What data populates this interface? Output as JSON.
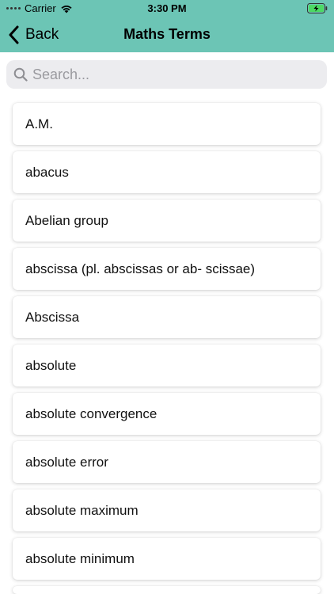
{
  "status_bar": {
    "carrier": "Carrier",
    "time": "3:30 PM"
  },
  "nav": {
    "back_label": "Back",
    "title": "Maths Terms"
  },
  "search": {
    "placeholder": "Search..."
  },
  "terms": [
    "A.M.",
    "abacus",
    "Abelian group",
    "abscissa (pl. abscissas or ab- scissae)",
    "Abscissa",
    "absolute",
    "absolute convergence",
    "absolute error",
    "absolute maximum",
    "absolute minimum",
    ""
  ],
  "colors": {
    "header": "#6cc5b5",
    "search_bg": "#ececef",
    "battery_fill": "#4cd964"
  }
}
